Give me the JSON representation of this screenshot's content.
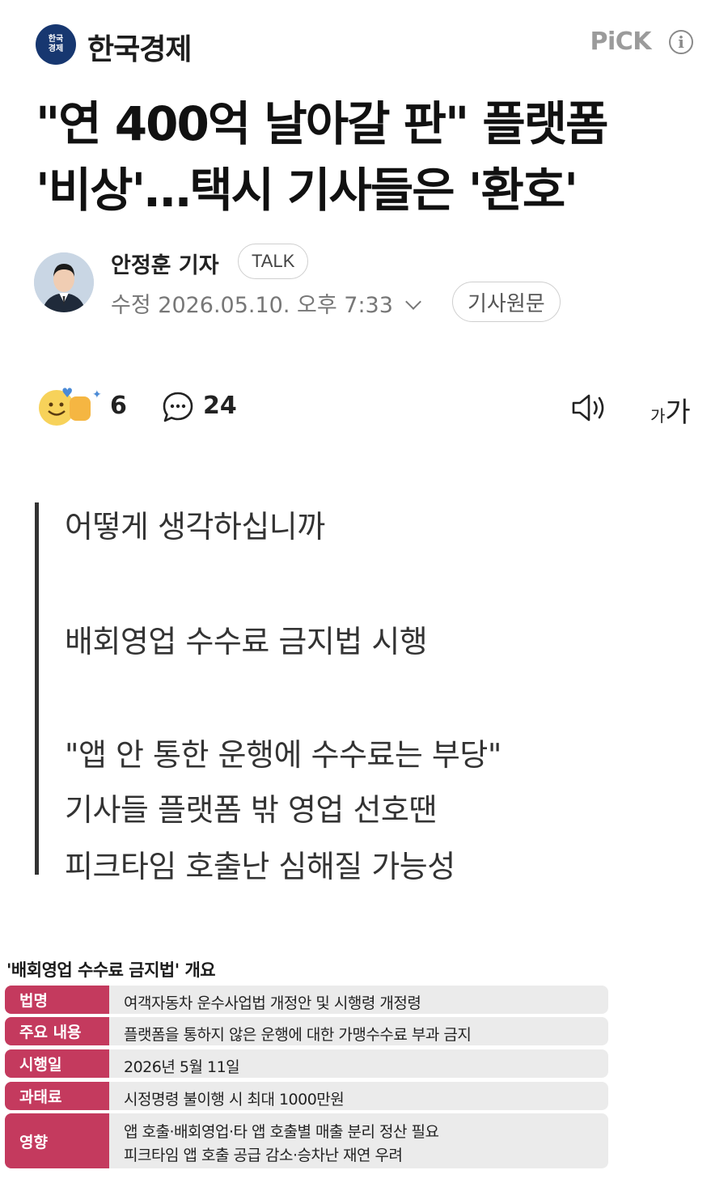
{
  "header": {
    "logo_line1": "한국",
    "logo_line2": "경제",
    "publisher": "한국경제",
    "pick_label": "PiCK",
    "info_glyph": "i"
  },
  "article": {
    "headline_line1": "\"연 400억 날아갈 판\" 플랫폼",
    "headline_line2": "'비상'…택시 기사들은 '환호'"
  },
  "byline": {
    "reporter": "안정훈 기자",
    "talk_label": "TALK",
    "date_text": "수정 2026.05.10. 오후 7:33",
    "original_button": "기사원문"
  },
  "reactions": {
    "reaction_count": "6",
    "comment_count": "24",
    "font_small": "가",
    "font_large": "가"
  },
  "summary": [
    "어떻게 생각하십니까",
    "배회영업 수수료 금지법 시행",
    "\"앱 안 통한 운행에 수수료는 부당\"",
    "기사들 플랫폼 밖 영업 선호땐",
    "피크타임 호출난 심해질 가능성"
  ],
  "table": {
    "title": "'배회영업 수수료 금지법' 개요",
    "rows": [
      {
        "label": "법명",
        "value": "여객자동차 운수사업법 개정안 및 시행령 개정령"
      },
      {
        "label": "주요 내용",
        "value": "플랫폼을 통하지 않은 운행에 대한 가맹수수료 부과 금지"
      },
      {
        "label": "시행일",
        "value": "2026년 5월 11일"
      },
      {
        "label": "과태료",
        "value": "시정명령 불이행 시 최대 1000만원"
      },
      {
        "label": "영향",
        "value": "앱 호출·배회영업·타 앱 호출별 매출 분리 정산 필요",
        "value2": "피크타임 앱 호출 공급 감소·승차난 재연 우려"
      }
    ]
  },
  "colors": {
    "brand_navy": "#173770",
    "label_red": "#c43a5e",
    "row_gray": "#ebebeb"
  }
}
